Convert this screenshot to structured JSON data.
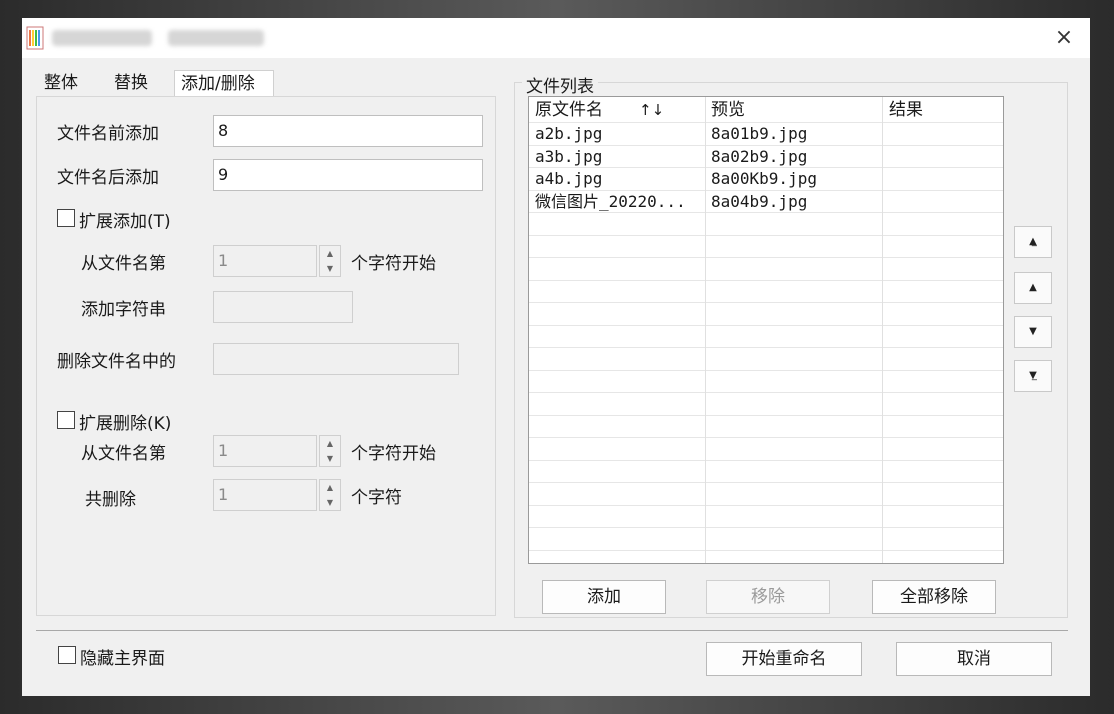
{
  "tabs": [
    "整体",
    "替换",
    "添加/删除"
  ],
  "form": {
    "prefix_label": "文件名前添加",
    "prefix_value": "8",
    "suffix_label": "文件名后添加",
    "suffix_value": "9",
    "ext_add_label": "扩展添加(T)",
    "from_label": "从文件名第",
    "from_value": "1",
    "start_suffix": "个字符开始",
    "add_str_label": "添加字符串",
    "add_str_value": "",
    "delete_label": "删除文件名中的",
    "delete_value": "",
    "ext_del_label": "扩展删除(K)",
    "del_from_label": "从文件名第",
    "del_from_value": "1",
    "del_start_suffix": "个字符开始",
    "del_count_label": "共删除",
    "del_count_value": "1",
    "del_count_suffix": "个字符"
  },
  "file_list": {
    "title": "文件列表",
    "columns": [
      "原文件名",
      "预览",
      "结果"
    ],
    "sort_icon": "↑↓",
    "rows": [
      {
        "original": "a2b.jpg",
        "preview": "8a01b9.jpg",
        "result": ""
      },
      {
        "original": "a3b.jpg",
        "preview": "8a02b9.jpg",
        "result": ""
      },
      {
        "original": "a4b.jpg",
        "preview": "8a00Kb9.jpg",
        "result": ""
      },
      {
        "original": "微信图片_20220...",
        "preview": "8a04b9.jpg",
        "result": ""
      }
    ],
    "add_button": "添加",
    "remove_button": "移除",
    "remove_all_button": "全部移除"
  },
  "bottom": {
    "hide_main_label": "隐藏主界面",
    "start_button": "开始重命名",
    "cancel_button": "取消"
  },
  "icons": {
    "close": "×",
    "move_top": "▲̲",
    "move_up": "▲",
    "move_down": "▼",
    "move_bottom": "▼̲"
  }
}
